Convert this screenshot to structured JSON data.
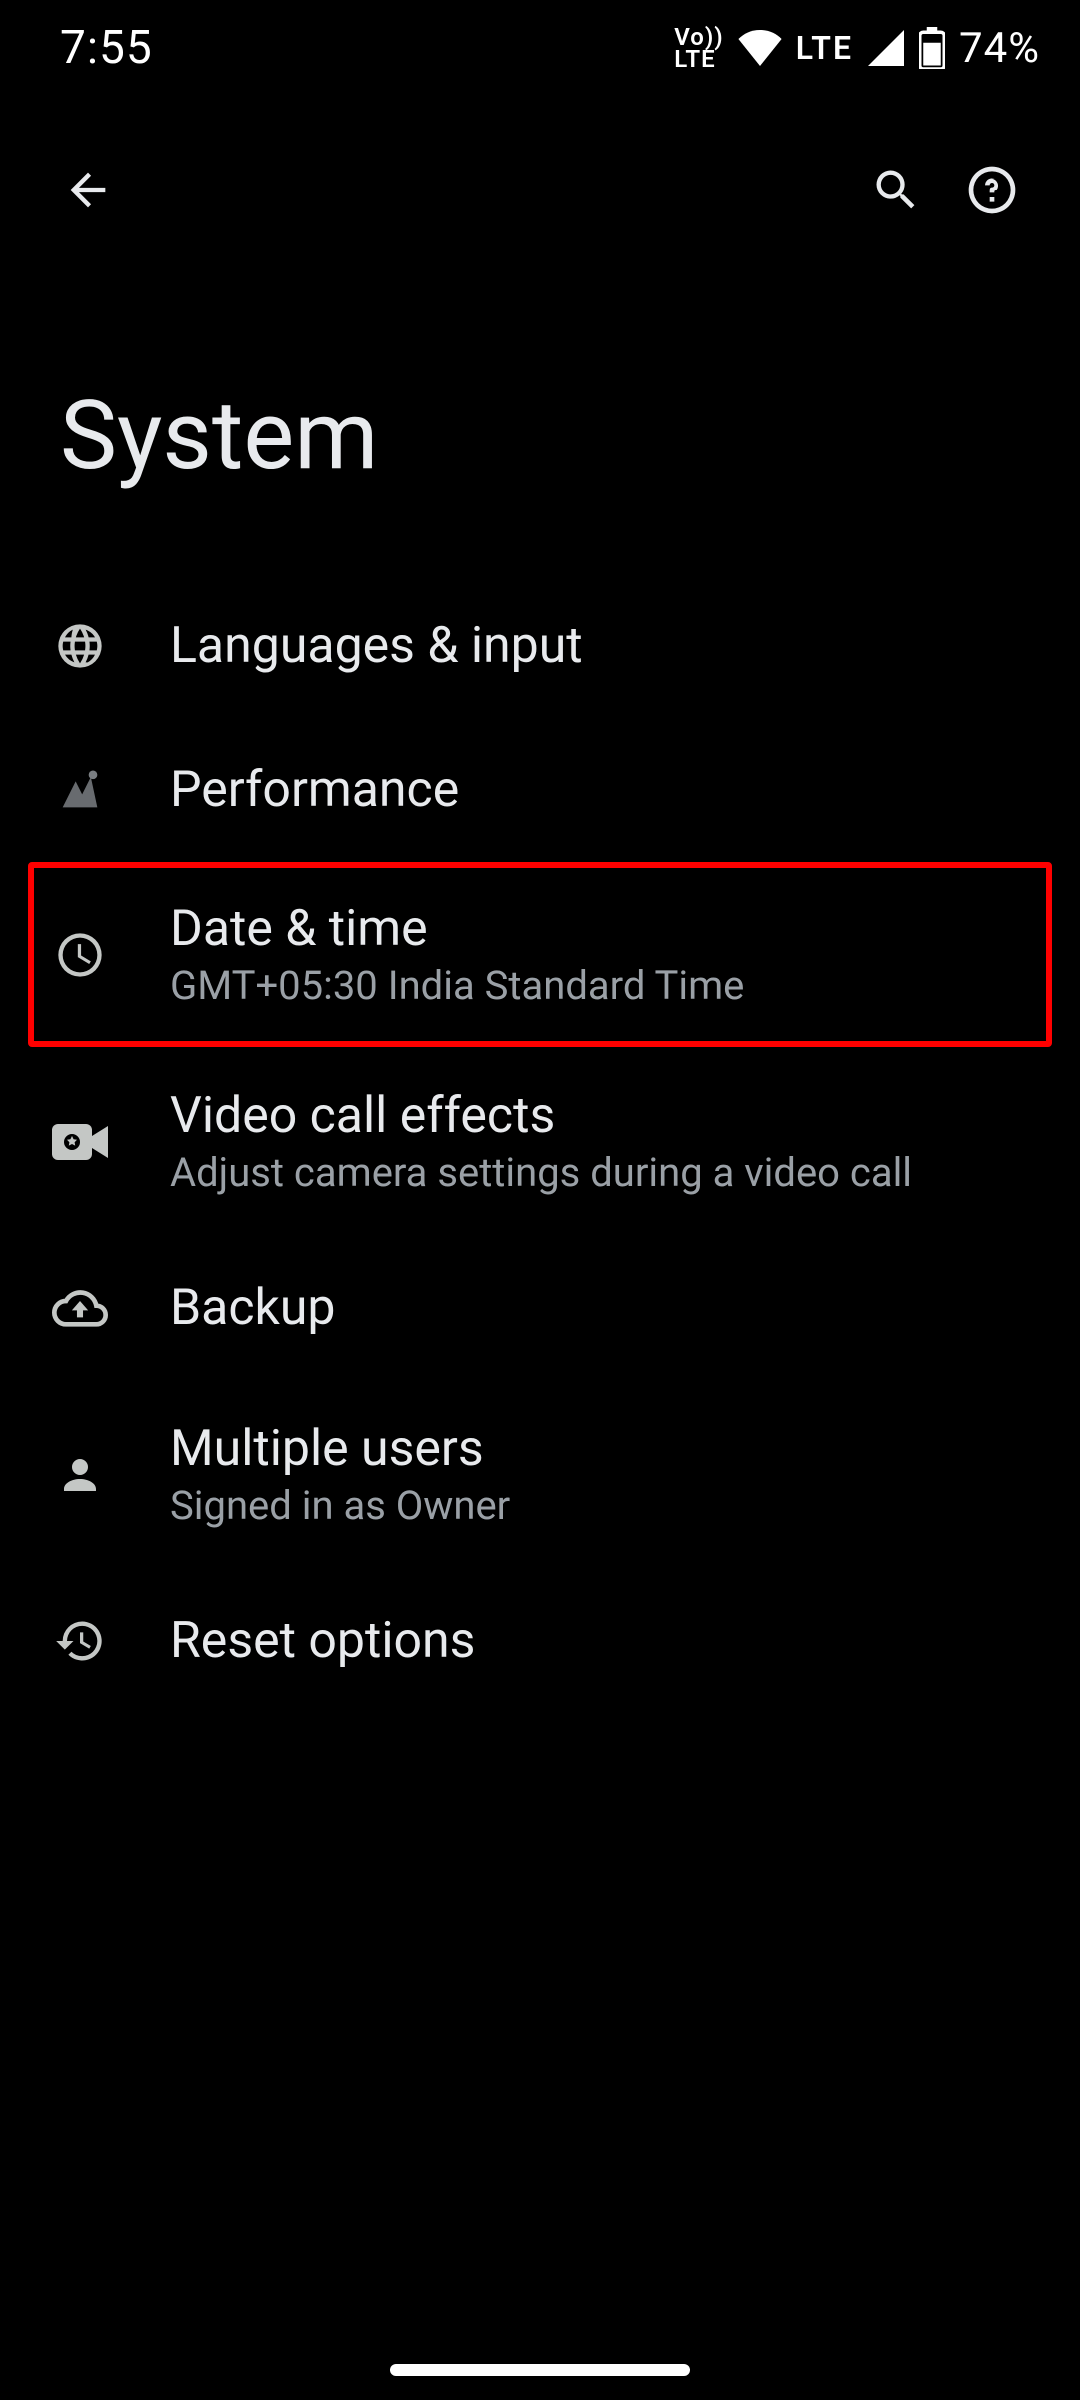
{
  "status": {
    "time": "7:55",
    "volte": "Vo\nLTE",
    "network_label": "LTE",
    "battery_text": "74%"
  },
  "page": {
    "title": "System"
  },
  "items": [
    {
      "icon": "globe",
      "title": "Languages & input"
    },
    {
      "icon": "performance",
      "title": "Performance"
    },
    {
      "icon": "clock",
      "title": "Date & time",
      "subtitle": "GMT+05:30 India Standard Time",
      "highlighted": true
    },
    {
      "icon": "video-gear",
      "title": "Video call effects",
      "subtitle": "Adjust camera settings during a video call"
    },
    {
      "icon": "cloud-up",
      "title": "Backup"
    },
    {
      "icon": "person",
      "title": "Multiple users",
      "subtitle": "Signed in as Owner"
    },
    {
      "icon": "history",
      "title": "Reset options"
    }
  ]
}
